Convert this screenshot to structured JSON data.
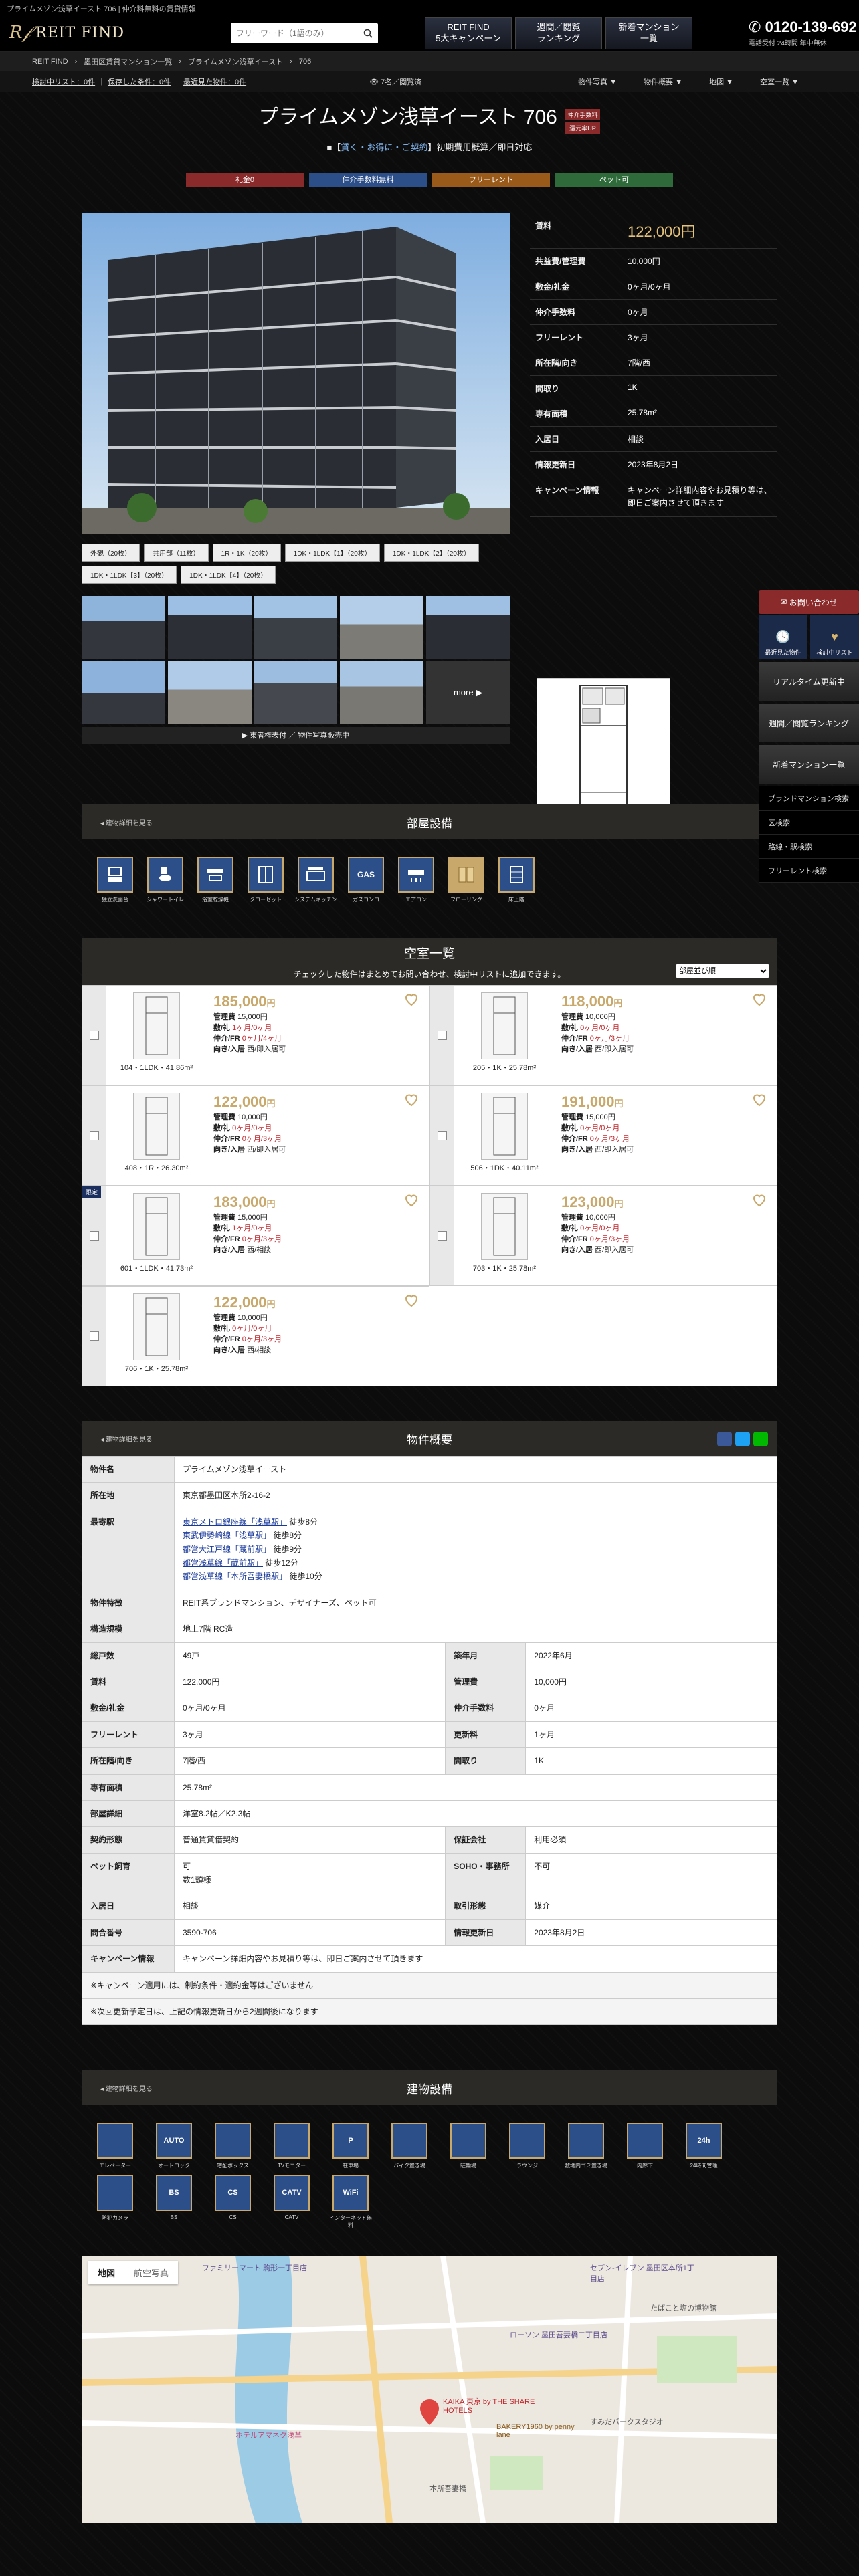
{
  "topline": "プライムメゾン浅草イースト 706 | 仲介料無料の賃貸情報",
  "header": {
    "brand": "REIT FIND",
    "search_placeholder": "フリーワード（1語のみ）",
    "banners": [
      "REIT FIND\n5大キャンペーン",
      "週間／閲覧\nランキング",
      "新着マンション\n一覧"
    ],
    "tel": "0120-139-692",
    "tel_sub": "電話受付 24時間 年中無休"
  },
  "breadcrumb": [
    "REIT FIND",
    "墨田区賃貸マンション一覧",
    "プライムメゾン浅草イースト",
    "706"
  ],
  "subbar": {
    "left": [
      "検討中リスト：0件",
      "保存した条件：0件",
      "最近見た物件：0件"
    ],
    "center": "7名／閲覧済",
    "menu": [
      "物件写真 ▼",
      "物件概要 ▼",
      "地図 ▼",
      "空室一覧 ▼"
    ]
  },
  "title": "プライムメゾン浅草イースト 706",
  "tags": [
    "仲介手数料",
    "還元率UP"
  ],
  "catch": {
    "prefix": "■【",
    "highlight": "賃く・お得に・ご契約",
    "suffix": "】初期費用概算／即日対応"
  },
  "colorbtns": [
    {
      "label": "礼金0",
      "color": "#8b2a2a"
    },
    {
      "label": "仲介手数料無料",
      "color": "#2c4f8a"
    },
    {
      "label": "フリーレント",
      "color": "#9a5a1a"
    },
    {
      "label": "ペット可",
      "color": "#2f6b3a"
    }
  ],
  "photo_captions": [
    "外観（20枚）",
    "共用部（11枚）",
    "1R・1K（20枚）",
    "1DK・1LDK【1】（20枚）",
    "1DK・1LDK【2】（20枚）",
    "1DK・1LDK【3】（20枚）",
    "1DK・1LDK【4】（20枚）"
  ],
  "thumb_more": "more ▶",
  "thumb_bar": "▶ 東者権表付 ／ 物件写真販売中",
  "spec": [
    {
      "k": "賃料",
      "v": "122,000円"
    },
    {
      "k": "共益費/管理費",
      "v": "10,000円"
    },
    {
      "k": "敷金/礼金",
      "v": "0ヶ月/0ヶ月"
    },
    {
      "k": "仲介手数料",
      "v": "0ヶ月"
    },
    {
      "k": "フリーレント",
      "v": "3ヶ月"
    },
    {
      "k": "所在階/向き",
      "v": "7階/西"
    },
    {
      "k": "間取り",
      "v": "1K"
    },
    {
      "k": "専有面積",
      "v": "25.78m²"
    },
    {
      "k": "入居日",
      "v": "相談"
    },
    {
      "k": "情報更新日",
      "v": "2023年8月2日"
    },
    {
      "k": "キャンペーン情報",
      "v": "キャンペーン詳細内容やお見積り等は、即日ご案内させて頂きます"
    }
  ],
  "sidenav": {
    "inquiry": "お問い合わせ",
    "icons": [
      "最近見た物件",
      "検討中リスト"
    ],
    "banners": [
      "リアルタイム更新中",
      "週間／閲覧ランキング",
      "新着マンション一覧"
    ],
    "links": [
      "ブランドマンション検索",
      "区検索",
      "路線・駅検索",
      "フリーレント検索"
    ]
  },
  "room_equipment": {
    "back": "◂ 建物詳細を見る",
    "title": "部屋設備",
    "items": [
      "独立洗面台",
      "シャワートイレ",
      "浴室乾燥機",
      "クローゼット",
      "システムキッチン",
      "ガスコンロ",
      "エアコン",
      "フローリング",
      "床上階"
    ]
  },
  "vacancy": {
    "title": "空室一覧",
    "note": "チェックした物件はまとめてお問い合わせ、検討中リストに追加できます。",
    "sort": "部屋並び順",
    "rooms": [
      {
        "label": "104・1LDK・41.86m²",
        "rent": "185,000",
        "fee": "15,000円",
        "deposit": "1ヶ月/0ヶ月",
        "fr": "0ヶ月/4ヶ月",
        "dir": "西/即入居可",
        "badge": ""
      },
      {
        "label": "205・1K・25.78m²",
        "rent": "118,000",
        "fee": "10,000円",
        "deposit": "0ヶ月/0ヶ月",
        "fr": "0ヶ月/3ヶ月",
        "dir": "西/即入居可",
        "badge": ""
      },
      {
        "label": "408・1R・26.30m²",
        "rent": "122,000",
        "fee": "10,000円",
        "deposit": "0ヶ月/0ヶ月",
        "fr": "0ヶ月/3ヶ月",
        "dir": "西/即入居可",
        "badge": ""
      },
      {
        "label": "506・1DK・40.11m²",
        "rent": "191,000",
        "fee": "15,000円",
        "deposit": "0ヶ月/0ヶ月",
        "fr": "0ヶ月/3ヶ月",
        "dir": "西/即入居可",
        "badge": ""
      },
      {
        "label": "601・1LDK・41.73m²",
        "rent": "183,000",
        "fee": "15,000円",
        "deposit": "1ヶ月/0ヶ月",
        "fr": "0ヶ月/3ヶ月",
        "dir": "西/相談",
        "badge": "限定"
      },
      {
        "label": "703・1K・25.78m²",
        "rent": "123,000",
        "fee": "10,000円",
        "deposit": "0ヶ月/0ヶ月",
        "fr": "0ヶ月/3ヶ月",
        "dir": "西/即入居可",
        "badge": ""
      },
      {
        "label": "706・1K・25.78m²",
        "rent": "122,000",
        "fee": "10,000円",
        "deposit": "0ヶ月/0ヶ月",
        "fr": "0ヶ月/3ヶ月",
        "dir": "西/相談",
        "badge": ""
      }
    ],
    "labels": {
      "fee": "管理費",
      "deposit": "敷/礼",
      "fr": "仲介/FR",
      "dir": "向き/入居",
      "yen": "円"
    }
  },
  "overview": {
    "back": "◂ 建物詳細を見る",
    "title": "物件概要",
    "name_k": "物件名",
    "name_v": "プライムメゾン浅草イースト",
    "addr_k": "所在地",
    "addr_v": "東京都墨田区本所2-16-2",
    "station_k": "最寄駅",
    "stations": [
      {
        "line": "東京メトロ銀座線「浅草駅」",
        "walk": "徒歩8分"
      },
      {
        "line": "東武伊勢崎線「浅草駅」",
        "walk": "徒歩8分"
      },
      {
        "line": "都営大江戸線「蔵前駅」",
        "walk": "徒歩9分"
      },
      {
        "line": "都営浅草線「蔵前駅」",
        "walk": "徒歩12分"
      },
      {
        "line": "都営浅草線「本所吾妻橋駅」",
        "walk": "徒歩10分"
      }
    ],
    "feature_k": "物件特徴",
    "feature_v": "REIT系ブランドマンション、デザイナーズ、ペット可",
    "struct_k": "構造規模",
    "struct_v": "地上7階 RC造",
    "pairs": [
      [
        {
          "k": "総戸数",
          "v": "49戸"
        },
        {
          "k": "築年月",
          "v": "2022年6月"
        }
      ],
      [
        {
          "k": "賃料",
          "v": "122,000円"
        },
        {
          "k": "管理費",
          "v": "10,000円"
        }
      ],
      [
        {
          "k": "敷金/礼金",
          "v": "0ヶ月/0ヶ月"
        },
        {
          "k": "仲介手数料",
          "v": "0ヶ月"
        }
      ],
      [
        {
          "k": "フリーレント",
          "v": "3ヶ月"
        },
        {
          "k": "更新料",
          "v": "1ヶ月"
        }
      ],
      [
        {
          "k": "所在階/向き",
          "v": "7階/西"
        },
        {
          "k": "間取り",
          "v": "1K"
        }
      ]
    ],
    "area_k": "専有面積",
    "area_v": "25.78m²",
    "layout_k": "部屋詳細",
    "layout_v": "洋室8.2帖／K2.3帖",
    "contract_k": "契約形態",
    "contract_v": "普通賃貸借契約",
    "guarantee_k": "保証会社",
    "guarantee_v": "利用必須",
    "pet_k": "ペット飼育",
    "pet_v": "可",
    "pet_v2": "数1頭様",
    "soho_k": "SOHO・事務所",
    "soho_v": "不可",
    "move_k": "入居日",
    "move_v": "相談",
    "deal_k": "取引形態",
    "deal_v": "媒介",
    "code_k": "問合番号",
    "code_v": "3590-706",
    "update_k": "情報更新日",
    "update_v": "2023年8月2日",
    "camp_k": "キャンペーン情報",
    "camp_v": "キャンペーン詳細内容やお見積り等は、即日ご案内させて頂きます",
    "note1": "※キャンペーン適用には、制約条件・適約金等はございません",
    "note2": "※次回更新予定日は、上記の情報更新日から2週間後になります"
  },
  "building_equipment": {
    "back": "◂ 建物詳細を見る",
    "title": "建物設備",
    "items": [
      "エレベーター",
      "オートロック",
      "宅配ボックス",
      "TVモニター",
      "駐車場",
      "バイク置き場",
      "駐輪場",
      "ラウンジ",
      "敷地内ゴミ置き場",
      "内廊下",
      "24時間管理",
      "防犯カメラ",
      "BS",
      "CS",
      "CATV",
      "インターネット無料"
    ],
    "codes": [
      "",
      "AUTO",
      "",
      "",
      "P",
      "",
      "",
      "",
      "",
      "",
      "24h",
      "",
      "BS",
      "CS",
      "CATV",
      "WiFi"
    ]
  },
  "map": {
    "tabs": [
      "地図",
      "航空写真"
    ],
    "labels": [
      "ファミリーマート 駒形一丁目店",
      "セブン-イレブン 墨田区本所1丁目店",
      "ローソン 墨田吾妻橋二丁目店",
      "KAIKA 東京 by THE SHARE HOTELS",
      "すみだパークスタジオ",
      "BAKERY1960 by penny lane",
      "たばこと塩の博物館",
      "ホテルアマネク浅草",
      "本所吾妻橋"
    ]
  }
}
